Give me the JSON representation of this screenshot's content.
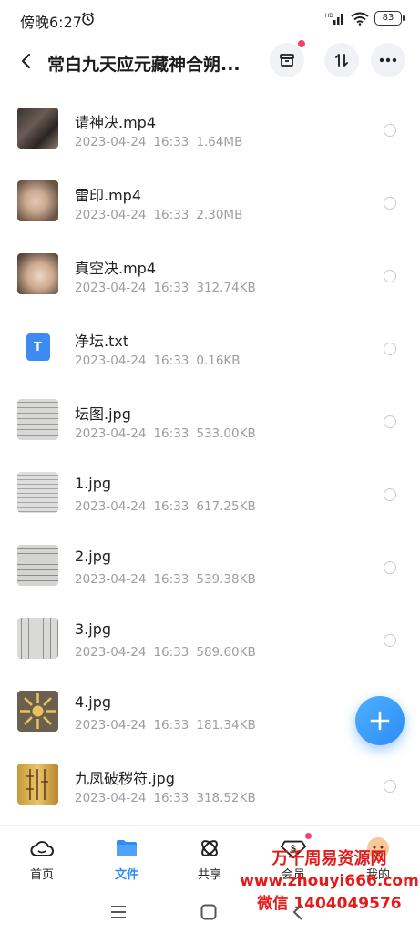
{
  "status_bar": {
    "time": "傍晚6:27",
    "signal_label": "HD",
    "battery": "83"
  },
  "header": {
    "title": "常白九天应元藏神合朔..."
  },
  "files": [
    {
      "name": "请神决.mp4",
      "date": "2023-04-24",
      "time": "16:33",
      "size": "1.64MB",
      "thumb": "video"
    },
    {
      "name": "雷印.mp4",
      "date": "2023-04-24",
      "time": "16:33",
      "size": "2.30MB",
      "thumb": "video"
    },
    {
      "name": "真空决.mp4",
      "date": "2023-04-24",
      "time": "16:33",
      "size": "312.74KB",
      "thumb": "video"
    },
    {
      "name": "净坛.txt",
      "date": "2023-04-24",
      "time": "16:33",
      "size": "0.16KB",
      "thumb": "txt",
      "badge": "T"
    },
    {
      "name": "坛图.jpg",
      "date": "2023-04-24",
      "time": "16:33",
      "size": "533.00KB",
      "thumb": "doc"
    },
    {
      "name": "1.jpg",
      "date": "2023-04-24",
      "time": "16:33",
      "size": "617.25KB",
      "thumb": "doc"
    },
    {
      "name": "2.jpg",
      "date": "2023-04-24",
      "time": "16:33",
      "size": "539.38KB",
      "thumb": "doc"
    },
    {
      "name": "3.jpg",
      "date": "2023-04-24",
      "time": "16:33",
      "size": "589.60KB",
      "thumb": "doc"
    },
    {
      "name": "4.jpg",
      "date": "2023-04-24",
      "time": "16:33",
      "size": "181.34KB",
      "thumb": "sun"
    },
    {
      "name": "九凤破秽符.jpg",
      "date": "2023-04-24",
      "time": "16:33",
      "size": "318.52KB",
      "thumb": "talisman"
    }
  ],
  "tabs": [
    {
      "label": "首页",
      "icon": "cloud-icon"
    },
    {
      "label": "文件",
      "icon": "folder-icon"
    },
    {
      "label": "共享",
      "icon": "share-icon"
    },
    {
      "label": "会员",
      "icon": "vip-icon"
    },
    {
      "label": "我的",
      "icon": "avatar-icon"
    }
  ],
  "watermark": {
    "line1": "万千周易资源网",
    "line2": "www.zhouyi666.com",
    "line3": "微信 1404049576"
  },
  "colors": {
    "accent": "#2d8cf5",
    "notification": "#f5426c",
    "watermark": "#e31b1b",
    "meta_text": "#9b9ea5"
  }
}
